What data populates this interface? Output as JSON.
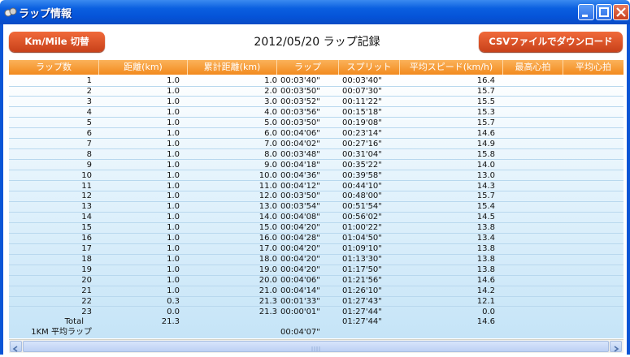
{
  "window": {
    "title": "ラップ情報",
    "controls": [
      "minimize",
      "maximize",
      "close"
    ]
  },
  "toolbar": {
    "km_mile_button": "Km/Mile 切替",
    "heading": "2012/05/20 ラップ記録",
    "csv_button": "CSVファイルでダウンロード"
  },
  "table": {
    "columns": [
      "ラップ数",
      "距離(km)",
      "累計距離(km)",
      "ラップ",
      "スプリット",
      "平均スピード(km/h)",
      "最高心拍",
      "平均心拍"
    ],
    "rows": [
      [
        "1",
        "1.0",
        "1.0",
        "00:03'40\"",
        "00:03'40\"",
        "16.4"
      ],
      [
        "2",
        "1.0",
        "2.0",
        "00:03'50\"",
        "00:07'30\"",
        "15.7"
      ],
      [
        "3",
        "1.0",
        "3.0",
        "00:03'52\"",
        "00:11'22\"",
        "15.5"
      ],
      [
        "4",
        "1.0",
        "4.0",
        "00:03'56\"",
        "00:15'18\"",
        "15.3"
      ],
      [
        "5",
        "1.0",
        "5.0",
        "00:03'50\"",
        "00:19'08\"",
        "15.7"
      ],
      [
        "6",
        "1.0",
        "6.0",
        "00:04'06\"",
        "00:23'14\"",
        "14.6"
      ],
      [
        "7",
        "1.0",
        "7.0",
        "00:04'02\"",
        "00:27'16\"",
        "14.9"
      ],
      [
        "8",
        "1.0",
        "8.0",
        "00:03'48\"",
        "00:31'04\"",
        "15.8"
      ],
      [
        "9",
        "1.0",
        "9.0",
        "00:04'18\"",
        "00:35'22\"",
        "14.0"
      ],
      [
        "10",
        "1.0",
        "10.0",
        "00:04'36\"",
        "00:39'58\"",
        "13.0"
      ],
      [
        "11",
        "1.0",
        "11.0",
        "00:04'12\"",
        "00:44'10\"",
        "14.3"
      ],
      [
        "12",
        "1.0",
        "12.0",
        "00:03'50\"",
        "00:48'00\"",
        "15.7"
      ],
      [
        "13",
        "1.0",
        "13.0",
        "00:03'54\"",
        "00:51'54\"",
        "15.4"
      ],
      [
        "14",
        "1.0",
        "14.0",
        "00:04'08\"",
        "00:56'02\"",
        "14.5"
      ],
      [
        "15",
        "1.0",
        "15.0",
        "00:04'20\"",
        "01:00'22\"",
        "13.8"
      ],
      [
        "16",
        "1.0",
        "16.0",
        "00:04'28\"",
        "01:04'50\"",
        "13.4"
      ],
      [
        "17",
        "1.0",
        "17.0",
        "00:04'20\"",
        "01:09'10\"",
        "13.8"
      ],
      [
        "18",
        "1.0",
        "18.0",
        "00:04'20\"",
        "01:13'30\"",
        "13.8"
      ],
      [
        "19",
        "1.0",
        "19.0",
        "00:04'20\"",
        "01:17'50\"",
        "13.8"
      ],
      [
        "20",
        "1.0",
        "20.0",
        "00:04'06\"",
        "01:21'56\"",
        "14.6"
      ],
      [
        "21",
        "1.0",
        "21.0",
        "00:04'14\"",
        "01:26'10\"",
        "14.2"
      ],
      [
        "22",
        "0.3",
        "21.3",
        "00:01'33\"",
        "01:27'43\"",
        "12.1"
      ],
      [
        "23",
        "0.0",
        "21.3",
        "00:00'01\"",
        "01:27'44\"",
        "0.0"
      ]
    ],
    "total": {
      "label": "Total",
      "distance": "21.3",
      "split": "01:27'44\"",
      "avg_speed": "14.6"
    },
    "avg_lap": {
      "label": "1KM 平均ラップ",
      "lap": "00:04'07\""
    }
  },
  "colors": {
    "title_bar": "#0a5fe0",
    "button": "#e0582a",
    "header": "#f5951f",
    "row_band": "#c5e4f7"
  }
}
